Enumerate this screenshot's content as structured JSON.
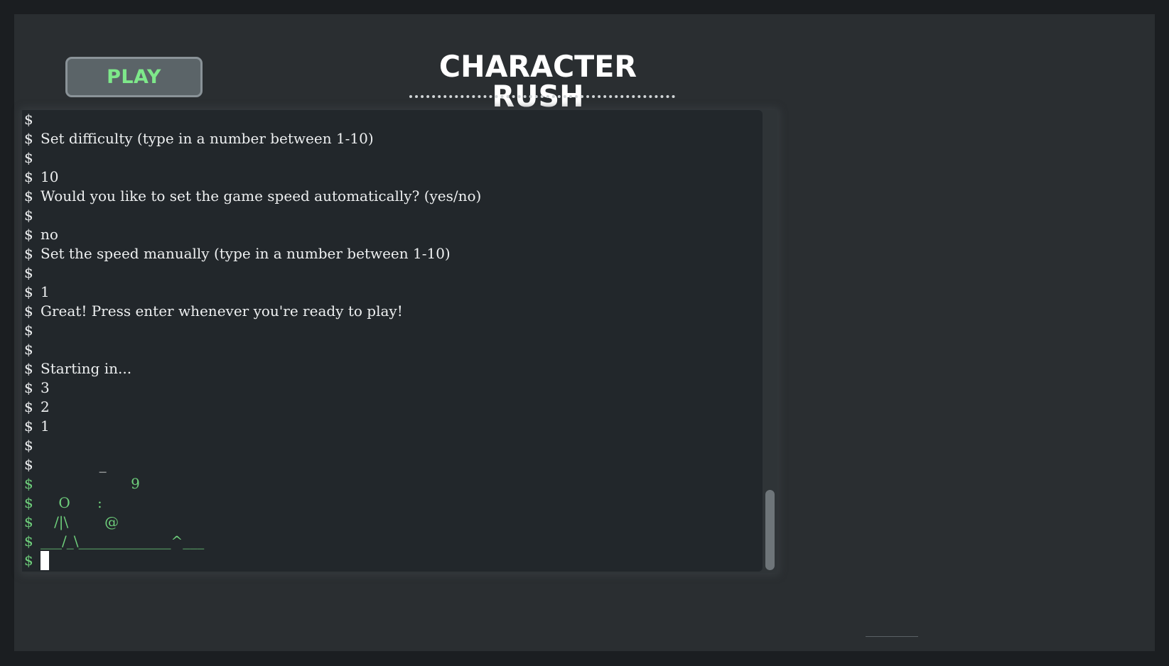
{
  "header": {
    "play_label": "PLAY",
    "title": "CHARACTER RUSH"
  },
  "terminal": {
    "prompt": "$",
    "lines": [
      {
        "text": "",
        "game": false
      },
      {
        "text": "Set difficulty (type in a number between 1-10)",
        "game": false
      },
      {
        "text": "",
        "game": false
      },
      {
        "text": "10",
        "game": false
      },
      {
        "text": "Would you like to set the game speed automatically? (yes/no)",
        "game": false
      },
      {
        "text": "",
        "game": false
      },
      {
        "text": "no",
        "game": false
      },
      {
        "text": "Set the speed manually (type in a number between 1-10)",
        "game": false
      },
      {
        "text": "",
        "game": false
      },
      {
        "text": "1",
        "game": false
      },
      {
        "text": "Great! Press enter whenever you're ready to play!",
        "game": false
      },
      {
        "text": "",
        "game": false
      },
      {
        "text": "",
        "game": false
      },
      {
        "text": "Starting in...",
        "game": false
      },
      {
        "text": "3",
        "game": false
      },
      {
        "text": "2",
        "game": false
      },
      {
        "text": "1",
        "game": false
      },
      {
        "text": "",
        "game": false
      },
      {
        "text": "             _",
        "game": false
      },
      {
        "text": "                    9",
        "game": true
      },
      {
        "text": "    O      :",
        "game": true
      },
      {
        "text": "   /|\\        @",
        "game": true
      },
      {
        "text": "___/_\\_____________^___",
        "game": true
      },
      {
        "text": "",
        "game": true,
        "cursor": true
      }
    ]
  }
}
